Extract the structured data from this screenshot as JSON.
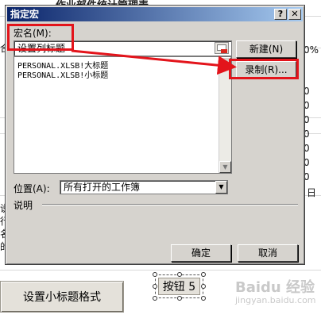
{
  "sheet": {
    "heading": "作业部件统计管理表",
    "left_fragments": [
      "合",
      "说",
      "行",
      "名",
      "的"
    ],
    "right_zeros": [
      "0%",
      "0",
      "0",
      "0",
      "0",
      "0",
      "0",
      "0"
    ],
    "right_extra": "日",
    "button_left_label": "设置小标题格式",
    "button_selected_label": "按钮 5",
    "watermark_text": "Baidu 经验",
    "watermark_url": "jingyan.baidu.com"
  },
  "dialog": {
    "title": "指定宏",
    "help_label": "?",
    "close_label": "✕",
    "macro_name_label": "宏名(M):",
    "macro_name_value": "设置列标题",
    "macro_list": [
      "PERSONAL.XLSB!大标题",
      "PERSONAL.XLSB!小标题"
    ],
    "new_button": "新建(N)",
    "record_button": "录制(R)...",
    "location_label": "位置(A):",
    "location_value": "所有打开的工作簿",
    "description_label": "说明",
    "ok_button": "确定",
    "cancel_button": "取消",
    "scroll_up_icon": "▲",
    "scroll_down_icon": "▼",
    "dropdown_icon": "▼"
  },
  "annotation_color": "#e3141b"
}
